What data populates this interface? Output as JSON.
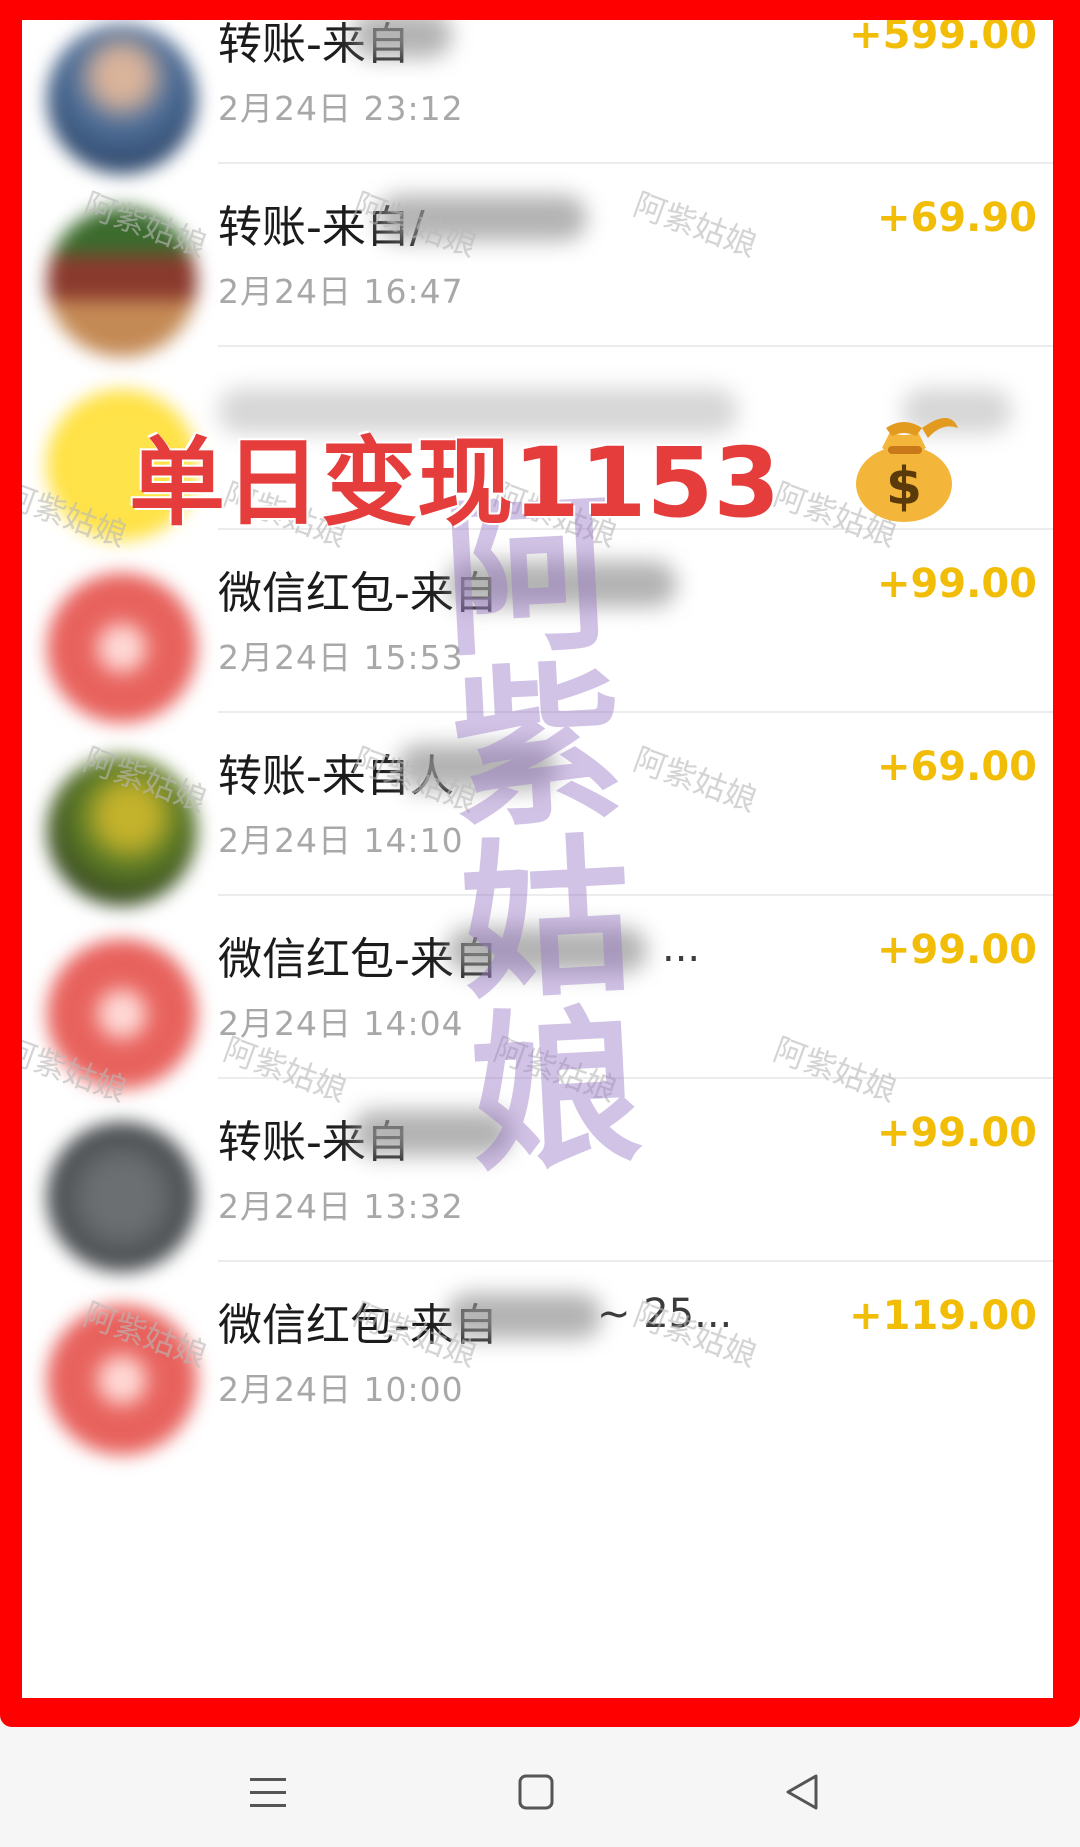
{
  "transactions": [
    {
      "title": "转账-来自",
      "suffix": "",
      "time": "2月24日 23:12",
      "amount": "+599.00",
      "avatar": "photo-blue"
    },
    {
      "title": "转账-来自/",
      "suffix": "",
      "time": "2月24日 16:47",
      "amount": "+69.90",
      "avatar": "photo-food"
    },
    {
      "title": "",
      "suffix": "",
      "time": "",
      "amount": "",
      "avatar": "yellow"
    },
    {
      "title": "微信红包-来自",
      "suffix": "",
      "time": "2月24日 15:53",
      "amount": "+99.00",
      "avatar": "red"
    },
    {
      "title": "转账-来自人",
      "suffix": "",
      "time": "2月24日 14:10",
      "amount": "+69.00",
      "avatar": "photo-green"
    },
    {
      "title": "微信红包-来自",
      "suffix": "...",
      "time": "2月24日 14:04",
      "amount": "+99.00",
      "avatar": "red"
    },
    {
      "title": "转账-来自",
      "suffix": "",
      "time": "2月24日 13:32",
      "amount": "+99.00",
      "avatar": "photo-dark"
    },
    {
      "title": "微信红包-来自",
      "suffix": "~ 25...",
      "time": "2月24日 10:00",
      "amount": "+119.00",
      "avatar": "red"
    }
  ],
  "banner": {
    "text": "单日变现1153",
    "icon": "money-bag-icon"
  },
  "watermark": {
    "big": [
      "阿",
      "紫",
      "姑",
      "娘"
    ],
    "small": "阿紫姑娘"
  },
  "colors": {
    "frame": "#ff0000",
    "amount": "#f2bd07",
    "banner": "#e53c3c"
  },
  "navbar": {
    "icons": [
      "menu-icon",
      "home-square-icon",
      "back-triangle-icon"
    ]
  }
}
